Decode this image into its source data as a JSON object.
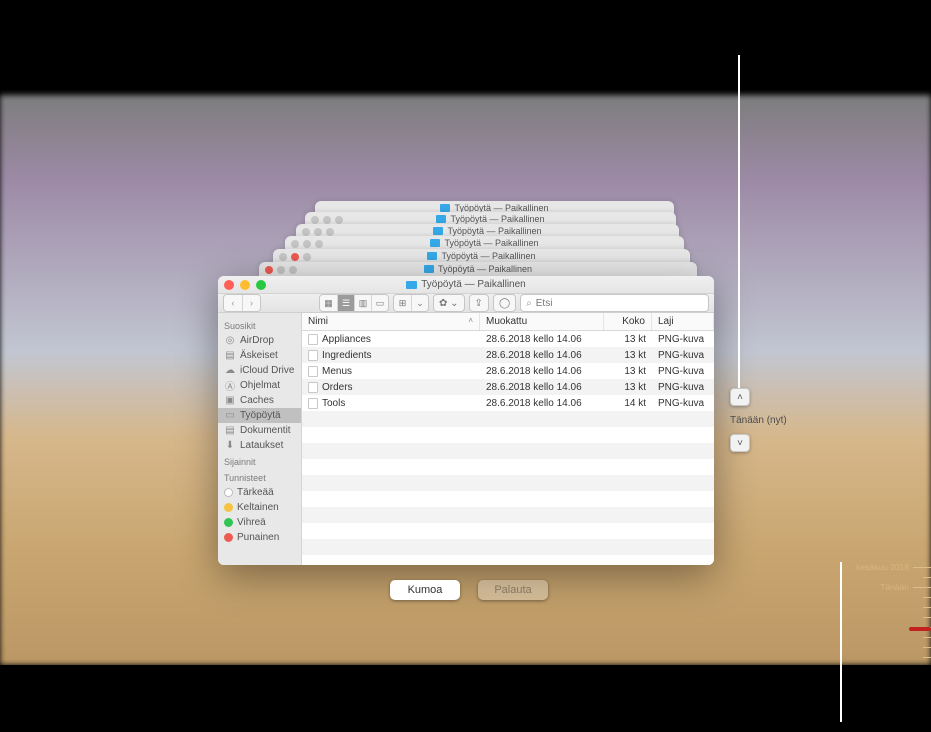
{
  "window": {
    "title": "Työpöytä — Paikallinen"
  },
  "toolbar": {
    "search_placeholder": "Etsi"
  },
  "sidebar": {
    "sections": {
      "favorites": "Suosikit",
      "locations": "Sijainnit",
      "tags": "Tunnisteet"
    },
    "items": [
      {
        "label": "AirDrop"
      },
      {
        "label": "Äskeiset"
      },
      {
        "label": "iCloud Drive"
      },
      {
        "label": "Ohjelmat"
      },
      {
        "label": "Caches"
      },
      {
        "label": "Työpöytä"
      },
      {
        "label": "Dokumentit"
      },
      {
        "label": "Lataukset"
      }
    ],
    "tags": [
      {
        "label": "Tärkeää",
        "color": "#ffffff"
      },
      {
        "label": "Keltainen",
        "color": "#f6c343"
      },
      {
        "label": "Vihreä",
        "color": "#30c552"
      },
      {
        "label": "Punainen",
        "color": "#ee5b52"
      }
    ]
  },
  "columns": {
    "name": "Nimi",
    "modified": "Muokattu",
    "size": "Koko",
    "kind": "Laji"
  },
  "files": [
    {
      "name": "Appliances",
      "modified": "28.6.2018 kello 14.06",
      "size": "13 kt",
      "kind": "PNG-kuva"
    },
    {
      "name": "Ingredients",
      "modified": "28.6.2018 kello 14.06",
      "size": "13 kt",
      "kind": "PNG-kuva"
    },
    {
      "name": "Menus",
      "modified": "28.6.2018 kello 14.06",
      "size": "13 kt",
      "kind": "PNG-kuva"
    },
    {
      "name": "Orders",
      "modified": "28.6.2018 kello 14.06",
      "size": "13 kt",
      "kind": "PNG-kuva"
    },
    {
      "name": "Tools",
      "modified": "28.6.2018 kello 14.06",
      "size": "14 kt",
      "kind": "PNG-kuva"
    }
  ],
  "buttons": {
    "cancel": "Kumoa",
    "restore": "Palauta"
  },
  "nav": {
    "now_label": "Tänään (nyt)"
  },
  "timeline": {
    "month": "kesäkuu 2018",
    "today": "Tänään"
  }
}
